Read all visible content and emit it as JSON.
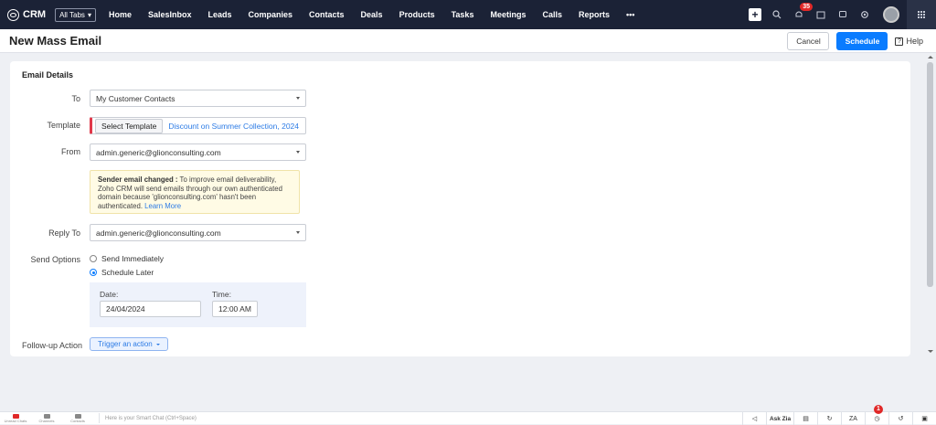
{
  "topbar": {
    "brand": "CRM",
    "all_tabs": "All Tabs",
    "nav": [
      "Home",
      "SalesInbox",
      "Leads",
      "Companies",
      "Contacts",
      "Deals",
      "Products",
      "Tasks",
      "Meetings",
      "Calls",
      "Reports",
      "•••"
    ],
    "notification_count": "35",
    "icons": [
      "plus-icon",
      "search-icon",
      "bell-icon",
      "calendar-icon",
      "feedback-icon",
      "settings-icon",
      "avatar",
      "apps-grid-icon"
    ]
  },
  "header": {
    "title": "New Mass Email",
    "cancel": "Cancel",
    "schedule": "Schedule",
    "help": "Help"
  },
  "form": {
    "section_title": "Email Details",
    "to_label": "To",
    "to_value": "My Customer Contacts",
    "template_label": "Template",
    "select_template": "Select Template",
    "template_name": "Discount on Summer Collection, 2024",
    "from_label": "From",
    "from_value": "admin.generic@glionconsulting.com",
    "warning_title": "Sender email changed :",
    "warning_text": " To improve email deliverability, Zoho CRM will send emails through our own authenticated domain because 'glionconsulting.com' hasn't been authenticated. ",
    "warning_link": "Learn More",
    "reply_to_label": "Reply To",
    "reply_to_value": "admin.generic@glionconsulting.com",
    "send_options_label": "Send Options",
    "send_immediately": "Send Immediately",
    "schedule_later": "Schedule Later",
    "selected_option": "Schedule Later",
    "date_label": "Date:",
    "date_value": "24/04/2024",
    "time_label": "Time:",
    "time_value": "12:00 AM",
    "followup_label": "Follow-up Action",
    "trigger_action": "Trigger an action"
  },
  "footer": {
    "left_items": [
      "Unread Chats",
      "Channels",
      "Contacts"
    ],
    "chat_placeholder": "Here is your Smart Chat (Ctrl+Space)",
    "ask_zia": "Ask Zia",
    "reminder_count": "1"
  }
}
